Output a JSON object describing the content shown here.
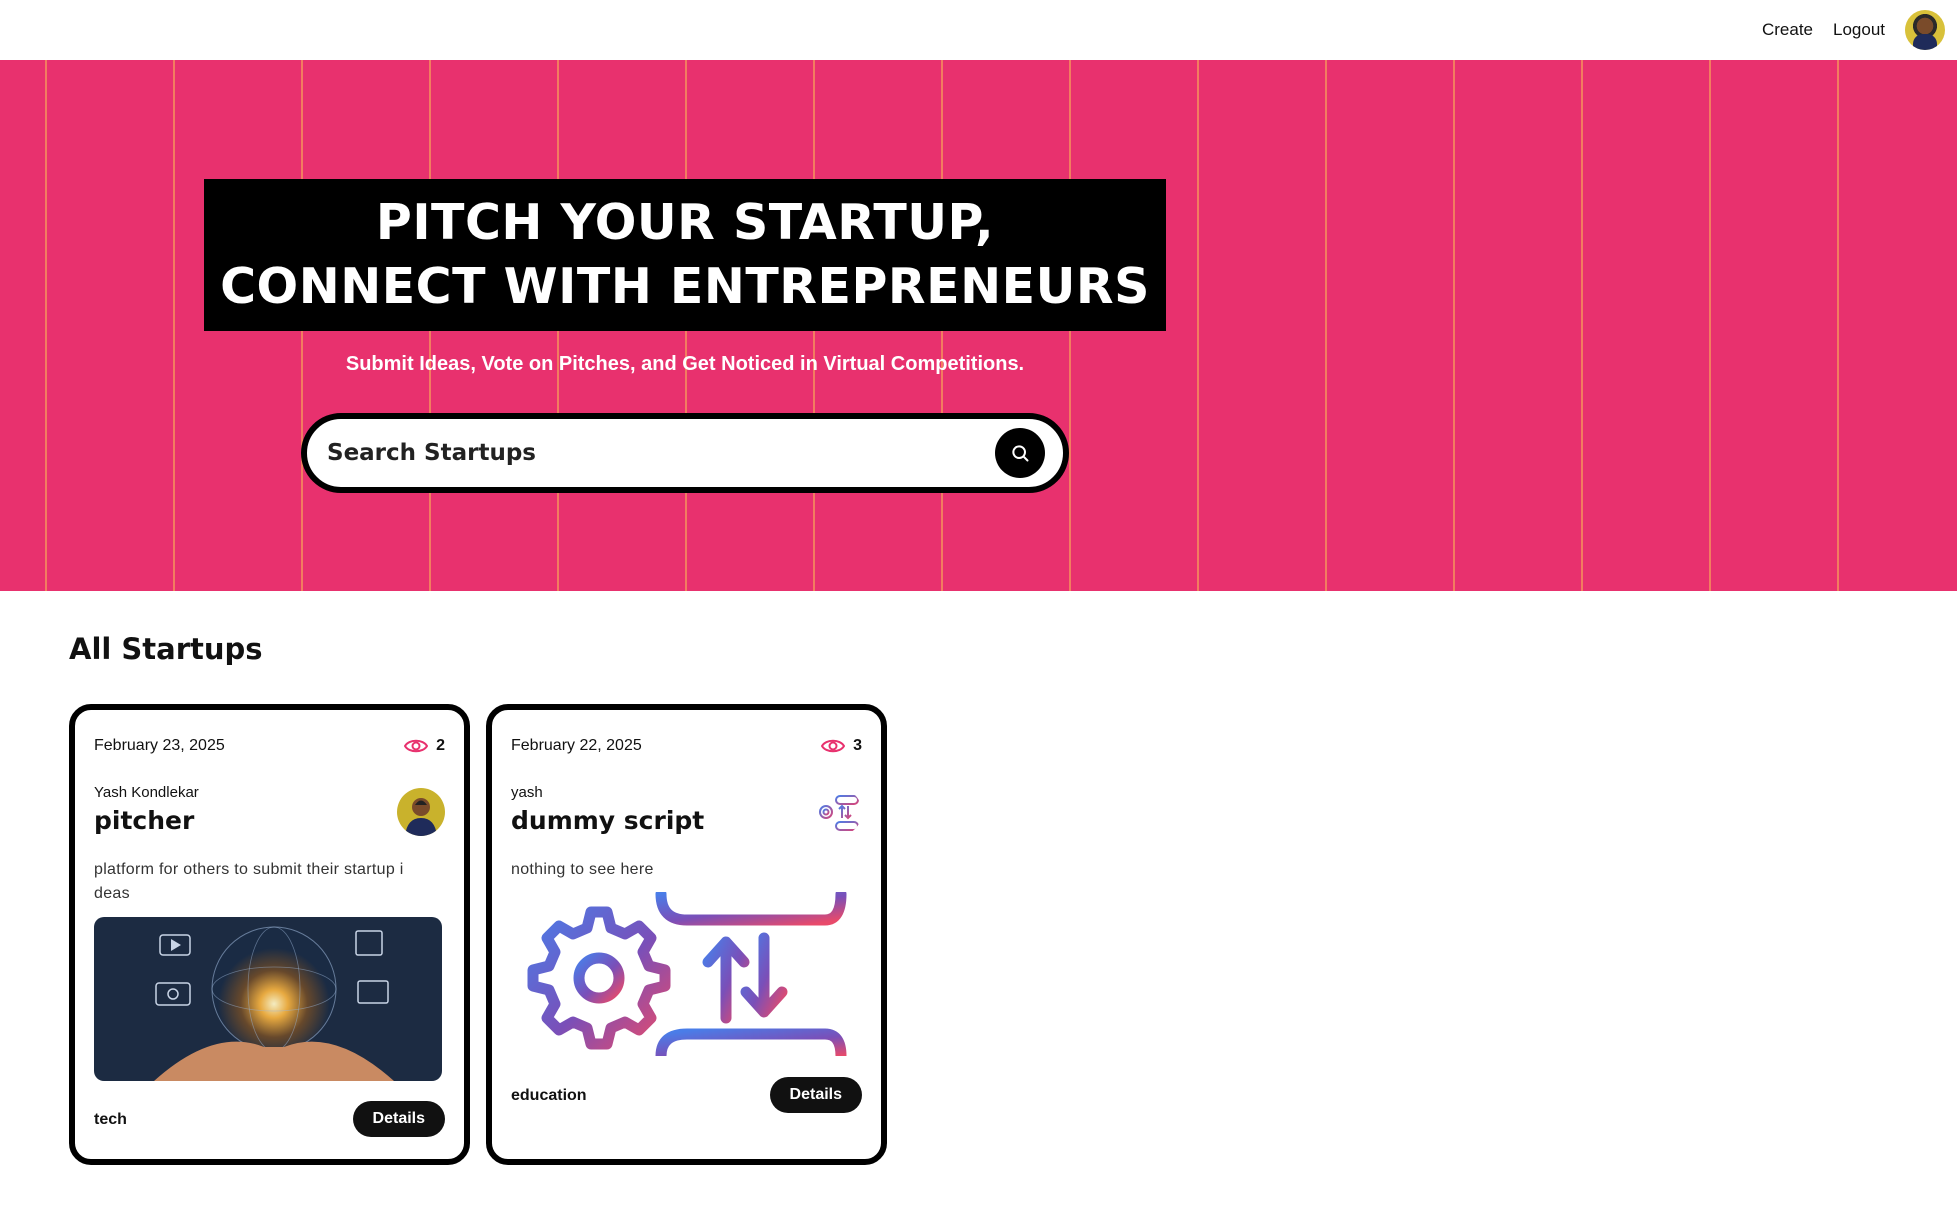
{
  "nav": {
    "create_label": "Create",
    "logout_label": "Logout"
  },
  "hero": {
    "headline_line1": "PITCH YOUR STARTUP,",
    "headline_line2": "CONNECT WITH ENTREPRENEURS",
    "subtitle": "Submit Ideas, Vote on Pitches, and Get Noticed in Virtual Competitions.",
    "search": {
      "placeholder": "Search Startups",
      "value": ""
    }
  },
  "section": {
    "title": "All Startups"
  },
  "cards": [
    {
      "date": "February 23, 2025",
      "views": "2",
      "author": "Yash Kondlekar",
      "title": "pitcher",
      "description": "platform for others to submit their startup i deas",
      "category": "tech",
      "details_label": "Details"
    },
    {
      "date": "February 22, 2025",
      "views": "3",
      "author": "yash",
      "title": "dummy script",
      "description": "nothing to see here",
      "category": "education",
      "details_label": "Details"
    }
  ],
  "colors": {
    "hero_bg": "#e8316e",
    "stripe": "#f38a5e",
    "accent": "#e8316e",
    "dark": "#000000"
  },
  "icons": {
    "search": "search-icon",
    "views": "eye-icon",
    "category_icon": "settings-icon"
  }
}
